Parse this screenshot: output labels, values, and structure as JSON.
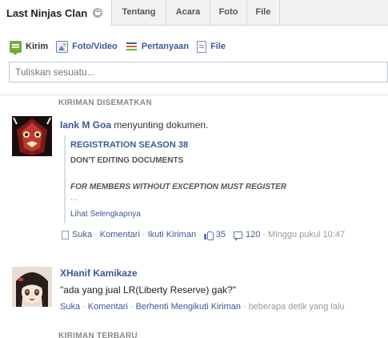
{
  "tabs": {
    "group_name": "Last Ninjas Clan",
    "items": [
      "Tentang",
      "Acara",
      "Foto",
      "File"
    ]
  },
  "composer": {
    "actions": [
      "Kirim",
      "Foto/Video",
      "Pertanyaan",
      "File"
    ],
    "placeholder": "Tuliskan sesuatu..."
  },
  "pinned": {
    "label": "KIRIMAN DISEMATKAN",
    "author": "Iank M Goa",
    "action_text": "menyunting dokumen.",
    "doc_title": "REGISTRATION SEASON 38",
    "doc_line1": "DON'T EDITING DOCUMENTS",
    "doc_line2": "FOR MEMBERS WITHOUT EXCEPTION MUST REGISTER",
    "doc_ellipsis": "...",
    "see_more": "Lihat Selengkapnya",
    "meta": {
      "like": "Suka",
      "comment": "Komentari",
      "follow": "Ikuti Kiriman",
      "likes_count": "35",
      "comments_count": "120",
      "time": "Minggu pukul 10:47"
    }
  },
  "post2": {
    "author": "XHanif Kamikaze",
    "text": "\"ada yang jual LR(Liberty Reserve) gak?\"",
    "meta": {
      "like": "Suka",
      "comment": "Komentari",
      "unfollow": "Berhenti Mengikuti Kiriman",
      "time": "beberapa detik yang lalu"
    }
  },
  "recent_label": "KIRIMAN TERBARU",
  "colors": {
    "link": "#3b5998",
    "tabbar_bg": "#f2f2f2",
    "muted": "#999999"
  }
}
